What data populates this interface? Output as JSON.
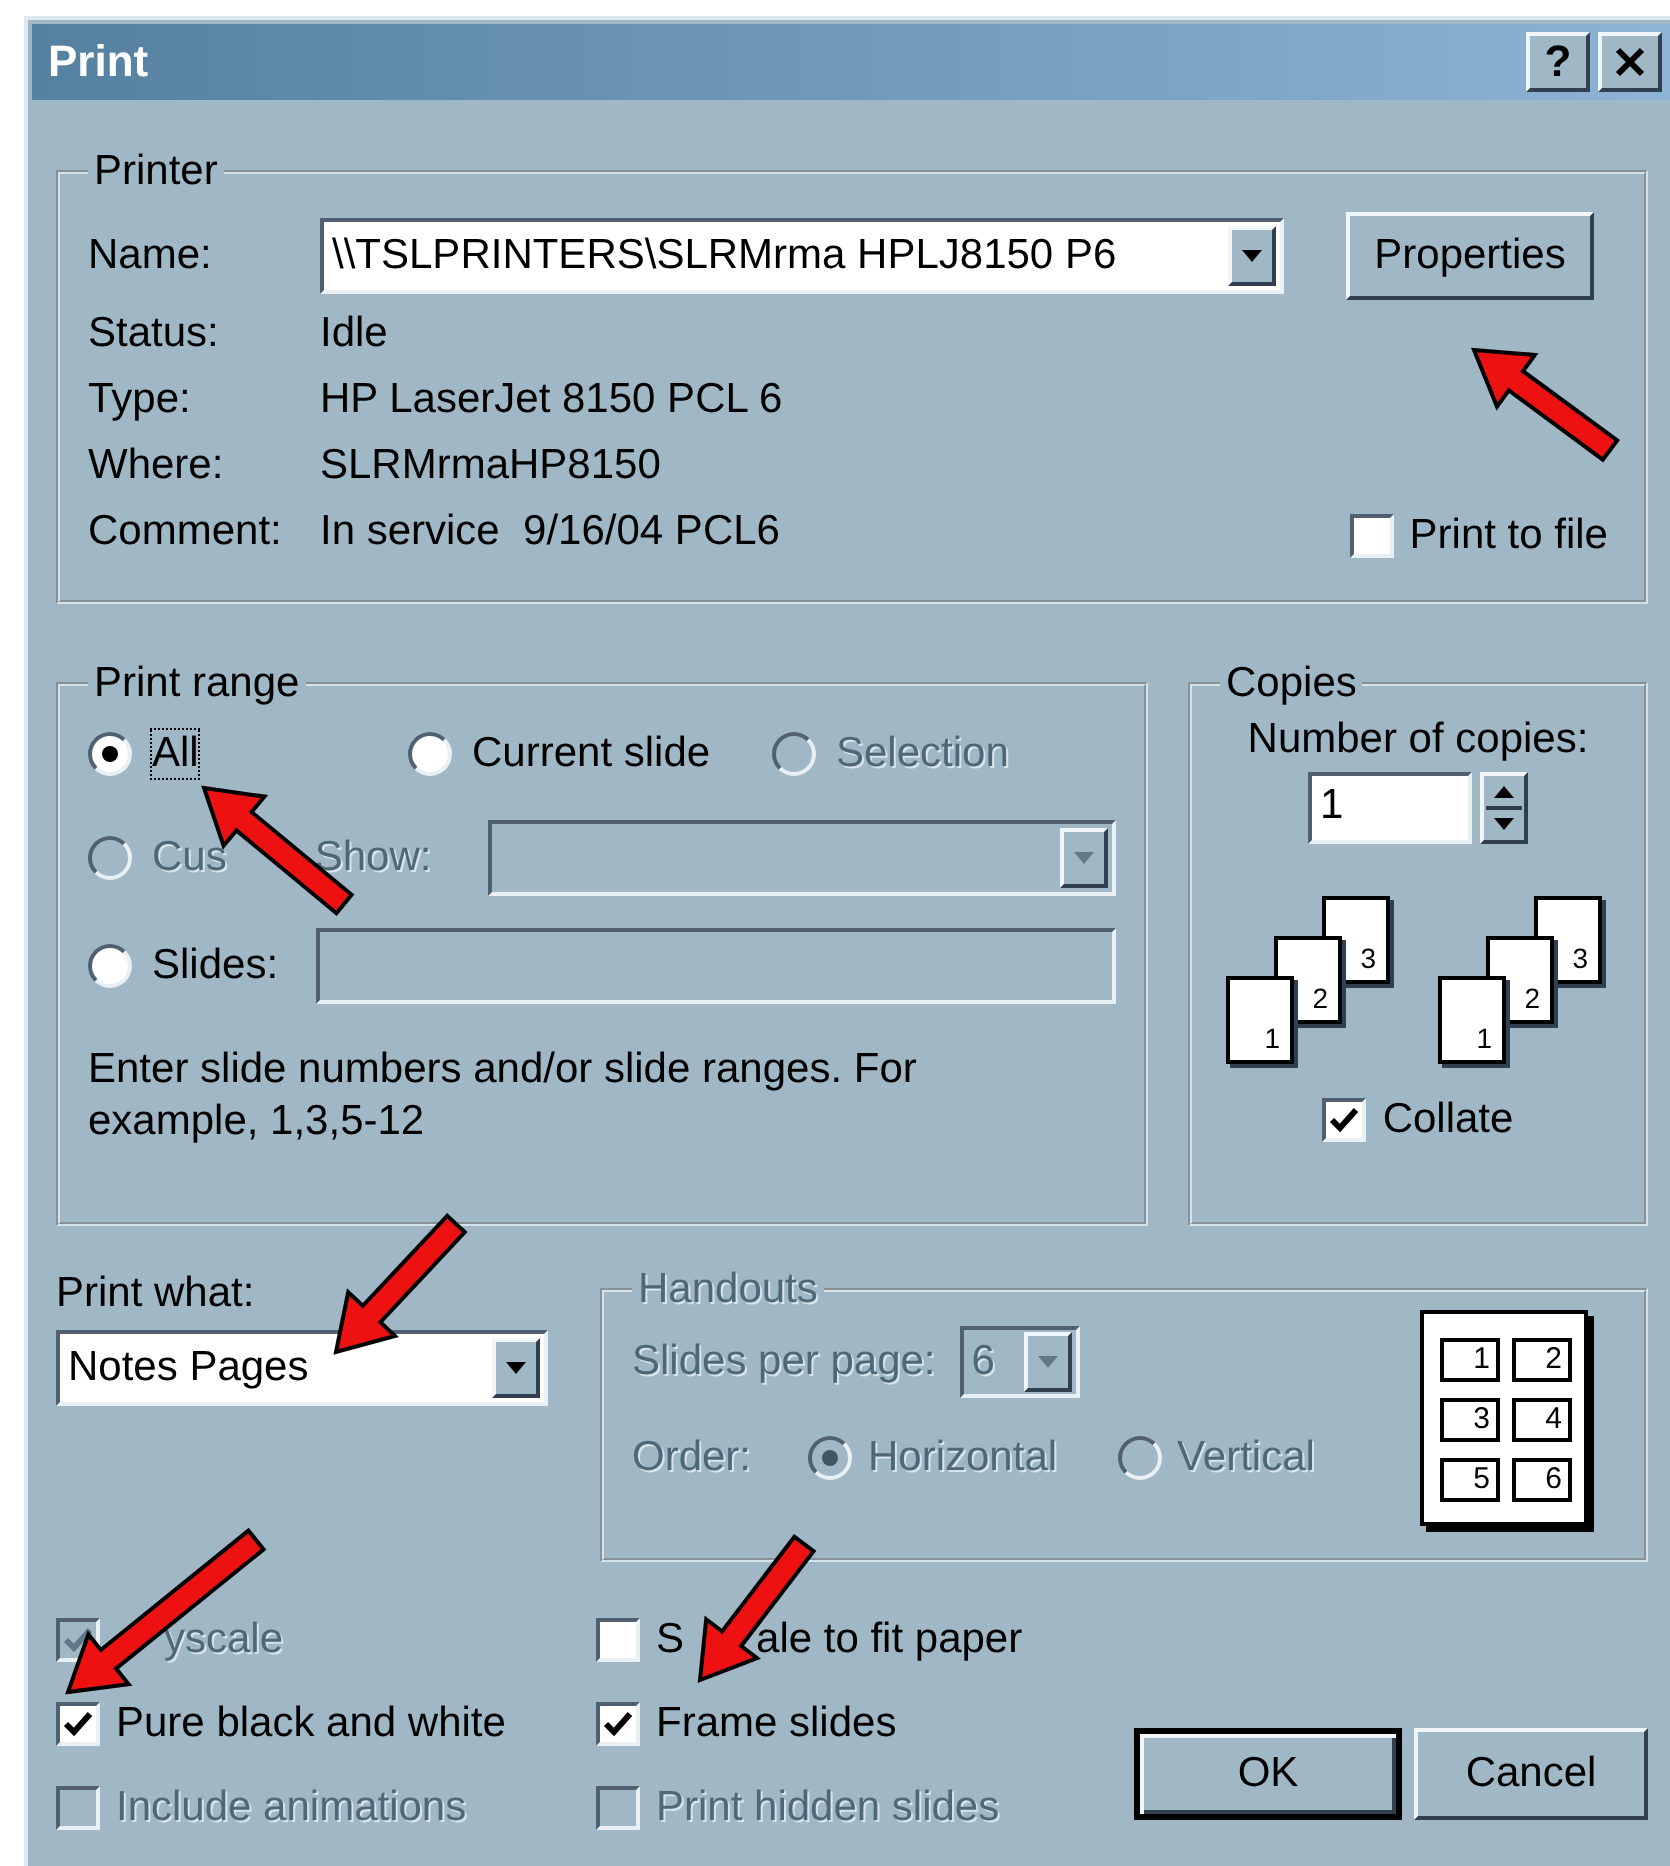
{
  "window": {
    "title": "Print",
    "help": "?"
  },
  "printer": {
    "group_label": "Printer",
    "name_label": "Name:",
    "name_value": "\\\\TSLPRINTERS\\SLRMrma HPLJ8150 P6",
    "properties": "Properties",
    "info": [
      {
        "label": "Status:",
        "value": "Idle"
      },
      {
        "label": "Type:",
        "value": "HP LaserJet 8150 PCL 6"
      },
      {
        "label": "Where:",
        "value": "SLRMrmaHP8150"
      },
      {
        "label": "Comment:",
        "value": "In service  9/16/04 PCL6"
      }
    ],
    "print_to_file": {
      "label": "Print to file",
      "checked": false
    }
  },
  "print_range": {
    "group_label": "Print range",
    "options": [
      {
        "kind": "radio",
        "label_parts": [
          "All"
        ],
        "selected": true,
        "disabled": false,
        "focused": true
      },
      {
        "kind": "radio",
        "label_parts": [
          "Current slide"
        ],
        "selected": false,
        "disabled": false,
        "focused": false
      },
      {
        "kind": "radio",
        "label_parts": [
          "Selection"
        ],
        "selected": false,
        "disabled": true,
        "focused": false
      },
      {
        "kind": "dropdown",
        "label_parts": [
          "Cus",
          "Show:"
        ],
        "selected": false,
        "disabled": true,
        "focused": false
      },
      {
        "kind": "field",
        "label_parts": [
          "Slides:"
        ],
        "selected": false,
        "disabled": false,
        "focused": false
      }
    ],
    "hint": "Enter slide numbers and/or slide ranges. For example, 1,3,5-12"
  },
  "copies": {
    "group_label": "Copies",
    "count_label": "Number of copies:",
    "count": "1",
    "stacks": [
      {
        "numbers": [
          "1",
          "2",
          "3"
        ]
      },
      {
        "numbers": [
          "1",
          "2",
          "3"
        ]
      }
    ],
    "collate": {
      "label": "Collate",
      "checked": true
    }
  },
  "print_what": {
    "label": "Print what:",
    "value": "Notes Pages"
  },
  "handouts": {
    "group_label": "Handouts",
    "disabled": true,
    "per_page_label": "Slides per page:",
    "per_page_value": "6",
    "order_label": "Order:",
    "orders": [
      {
        "label": "Horizontal",
        "selected": true
      },
      {
        "label": "Vertical",
        "selected": false
      }
    ],
    "preview_numbers": [
      "1",
      "2",
      "3",
      "4",
      "5",
      "6"
    ]
  },
  "options": [
    {
      "label_parts": [
        "yscale"
      ],
      "checked": true,
      "disabled": true
    },
    {
      "label_parts": [
        "S",
        "ale to fit paper"
      ],
      "checked": false,
      "disabled": false
    },
    {
      "label_parts": [
        "Pure black and white"
      ],
      "checked": true,
      "disabled": false
    },
    {
      "label_parts": [
        "Frame slides"
      ],
      "checked": true,
      "disabled": false
    },
    {
      "label_parts": [
        "Include animations"
      ],
      "checked": false,
      "disabled": true
    },
    {
      "label_parts": [
        "Print hidden slides"
      ],
      "checked": false,
      "disabled": true
    }
  ],
  "buttons": [
    {
      "label": "OK",
      "default": true
    },
    {
      "label": "Cancel",
      "default": false
    }
  ]
}
